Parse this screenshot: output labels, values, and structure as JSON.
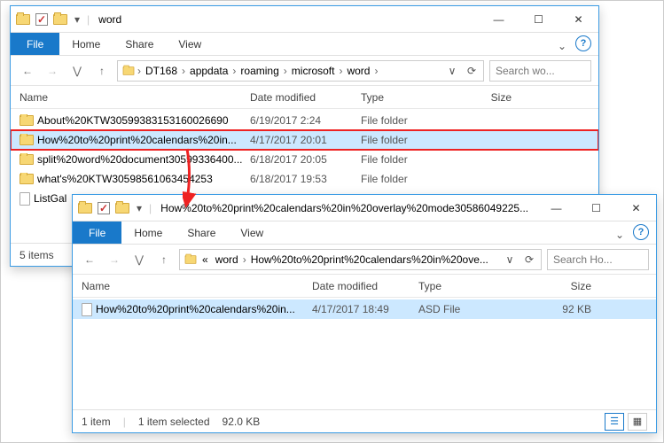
{
  "window1": {
    "title": "word",
    "ribbon": {
      "file": "File",
      "home": "Home",
      "share": "Share",
      "view": "View"
    },
    "breadcrumbs": [
      "DT168",
      "appdata",
      "roaming",
      "microsoft",
      "word"
    ],
    "search_placeholder": "Search wo...",
    "columns": {
      "name": "Name",
      "date": "Date modified",
      "type": "Type",
      "size": "Size"
    },
    "rows": [
      {
        "icon": "folder",
        "name": "About%20KTW30599383153160026690",
        "date": "6/19/2017 2:24",
        "type": "File folder",
        "size": "",
        "selected": false
      },
      {
        "icon": "folder",
        "name": "How%20to%20print%20calendars%20in...",
        "date": "4/17/2017 20:01",
        "type": "File folder",
        "size": "",
        "selected": true,
        "highlighted": true
      },
      {
        "icon": "folder",
        "name": "split%20word%20document30599336400...",
        "date": "6/18/2017 20:05",
        "type": "File folder",
        "size": "",
        "selected": false
      },
      {
        "icon": "folder",
        "name": "what's%20KTW30598561063454253",
        "date": "6/18/2017 19:53",
        "type": "File folder",
        "size": "",
        "selected": false
      },
      {
        "icon": "file",
        "name": "ListGal",
        "date": "",
        "type": "",
        "size": "",
        "selected": false
      }
    ],
    "status": {
      "items": "5 items"
    }
  },
  "window2": {
    "title": "How%20to%20print%20calendars%20in%20overlay%20mode30586049225...",
    "ribbon": {
      "file": "File",
      "home": "Home",
      "share": "Share",
      "view": "View"
    },
    "breadcrumbs_prefix": "«",
    "breadcrumbs": [
      "word",
      "How%20to%20print%20calendars%20in%20ove..."
    ],
    "search_placeholder": "Search Ho...",
    "columns": {
      "name": "Name",
      "date": "Date modified",
      "type": "Type",
      "size": "Size"
    },
    "rows": [
      {
        "icon": "file",
        "name": "How%20to%20print%20calendars%20in...",
        "date": "4/17/2017 18:49",
        "type": "ASD File",
        "size": "92 KB",
        "selected": true
      }
    ],
    "status": {
      "items": "1 item",
      "selected": "1 item selected",
      "selsize": "92.0 KB"
    }
  },
  "glyphs": {
    "min": "—",
    "max": "☐",
    "close": "✕",
    "back": "←",
    "fwd": "→",
    "up": "↑",
    "sep": "›",
    "dropdown": "∨",
    "refresh": "⟳",
    "recent": "⋁"
  }
}
